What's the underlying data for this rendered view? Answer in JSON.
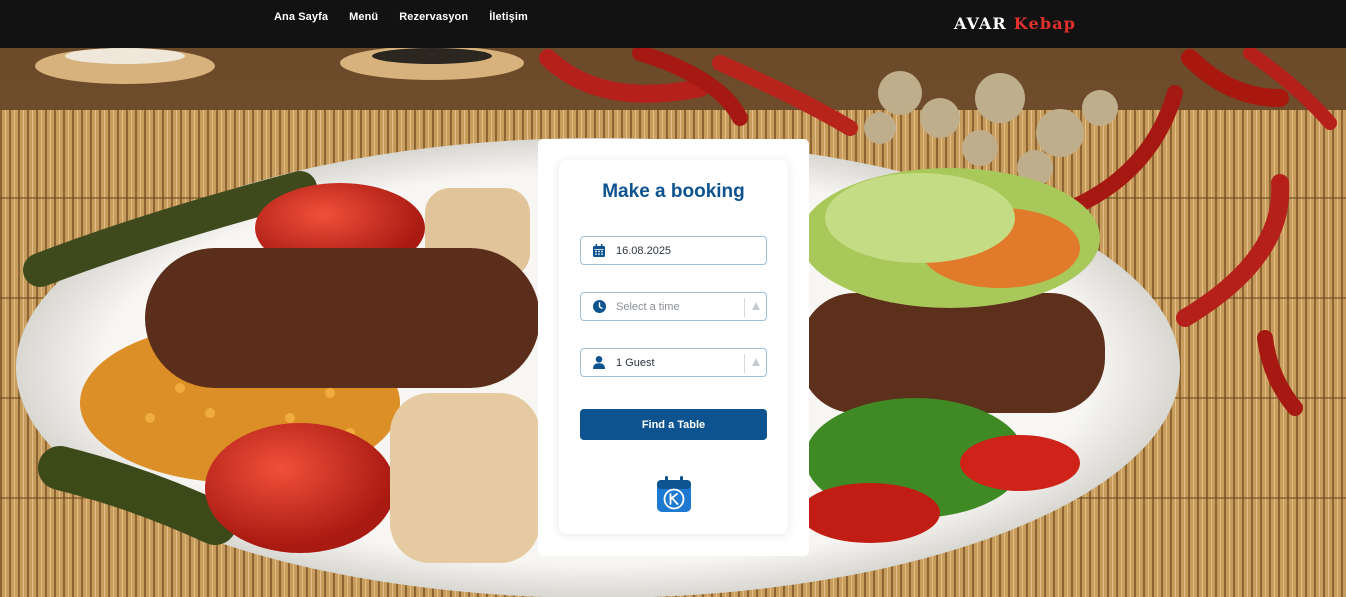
{
  "nav": {
    "items": [
      "Ana Sayfa",
      "Menü",
      "Rezervasyon",
      "İletişim"
    ],
    "brand_first": "AVAR",
    "brand_second": "Kebap"
  },
  "booking": {
    "title": "Make a booking",
    "date_value": "16.08.2025",
    "time_placeholder": "Select a time",
    "guests_value": "1 Guest",
    "submit_label": "Find a Table"
  },
  "icons": {
    "date": "calendar-icon",
    "time": "clock-icon",
    "guests": "user-icon",
    "dropdown": "triangle-up-icon",
    "footer_logo": "reservation-calendar-logo"
  },
  "colors": {
    "accent": "#0c5390",
    "brand_red": "#e0312c",
    "navbar": "#121212",
    "field_border": "#9cc0dc"
  }
}
